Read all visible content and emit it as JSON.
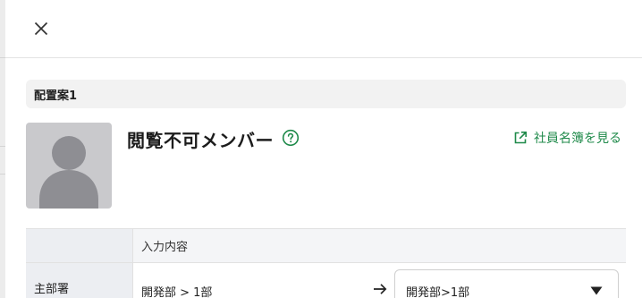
{
  "dialog": {
    "close_icon": "close-icon",
    "section_title": "配置案1",
    "member": {
      "avatar_icon": "person-placeholder-icon",
      "name": "閲覧不可メンバー",
      "help_icon": "question-circle-icon",
      "directory_link_label": "社員名簿を見る",
      "directory_link_icon": "external-link-icon"
    },
    "table": {
      "header_input_label": "入力内容",
      "rows": [
        {
          "label": "主部署",
          "current_value": "開発部 > 1部",
          "arrow_icon": "arrow-right-icon",
          "selected_value": "開発部>1部",
          "caret_icon": "caret-down-icon"
        }
      ]
    }
  },
  "colors": {
    "accent_green": "#1f8a4a",
    "section_bg": "#f2f2f2",
    "avatar_bg": "#c9c9cc"
  }
}
